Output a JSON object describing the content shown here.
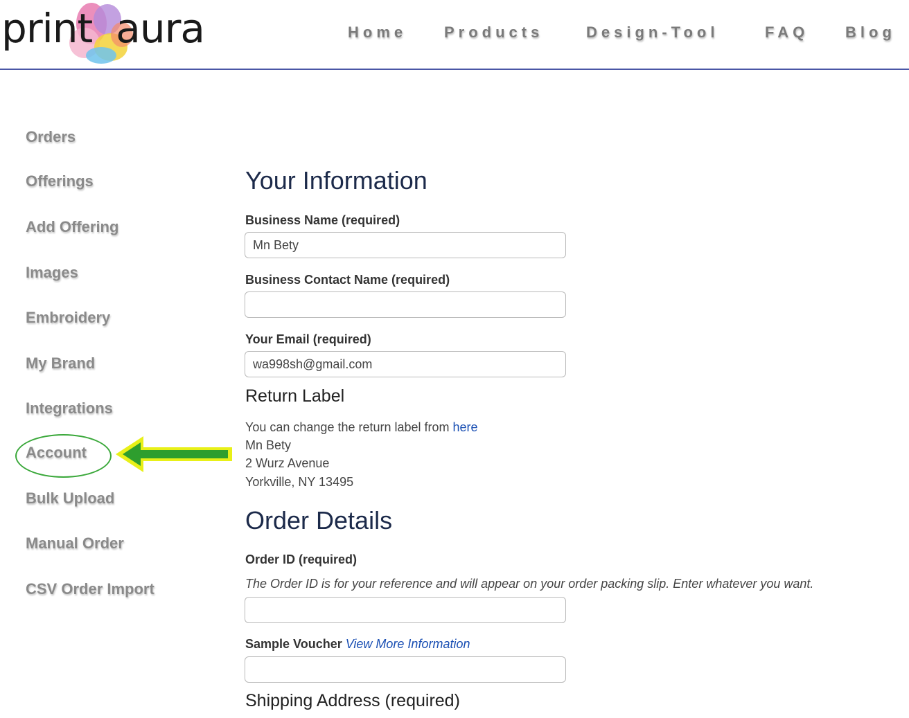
{
  "brand": {
    "logo_word1": "print",
    "logo_word2": "aura"
  },
  "nav": {
    "items": [
      "Home",
      "Products",
      "Design-Tool",
      "FAQ",
      "Blog"
    ]
  },
  "sidebar": {
    "items": [
      "Orders",
      "Offerings",
      "Add Offering",
      "Images",
      "Embroidery",
      "My Brand",
      "Integrations",
      "Account",
      "Bulk Upload",
      "Manual Order",
      "CSV Order Import"
    ],
    "highlighted": "Account"
  },
  "your_information": {
    "heading": "Your Information",
    "business_name": {
      "label": "Business Name (required)",
      "value": "Mn Bety"
    },
    "contact_name": {
      "label": "Business Contact Name (required)",
      "value": ""
    },
    "email": {
      "label": "Your Email (required)",
      "value": "wa998sh@gmail.com"
    }
  },
  "return_label": {
    "heading": "Return Label",
    "note_prefix": "You can change the return label from ",
    "note_link": "here",
    "address_lines": [
      "Mn Bety",
      "2 Wurz Avenue",
      "Yorkville, NY 13495"
    ]
  },
  "order_details": {
    "heading": "Order Details",
    "order_id": {
      "label": "Order ID (required)",
      "hint": "The Order ID is for your reference and will appear on your order packing slip. Enter whatever you want.",
      "value": ""
    },
    "sample_voucher": {
      "label": "Sample Voucher",
      "link": "View More Information",
      "value": ""
    },
    "shipping_heading": "Shipping Address (required)"
  },
  "colors": {
    "nav_text": "#7a7a7a",
    "header_rule": "#4a56a6",
    "link": "#1a4fb3",
    "heading": "#1c2a4a",
    "highlight_ring": "#3aa83a",
    "arrow_fill": "#2e9e2e",
    "arrow_outline": "#e8f018"
  }
}
